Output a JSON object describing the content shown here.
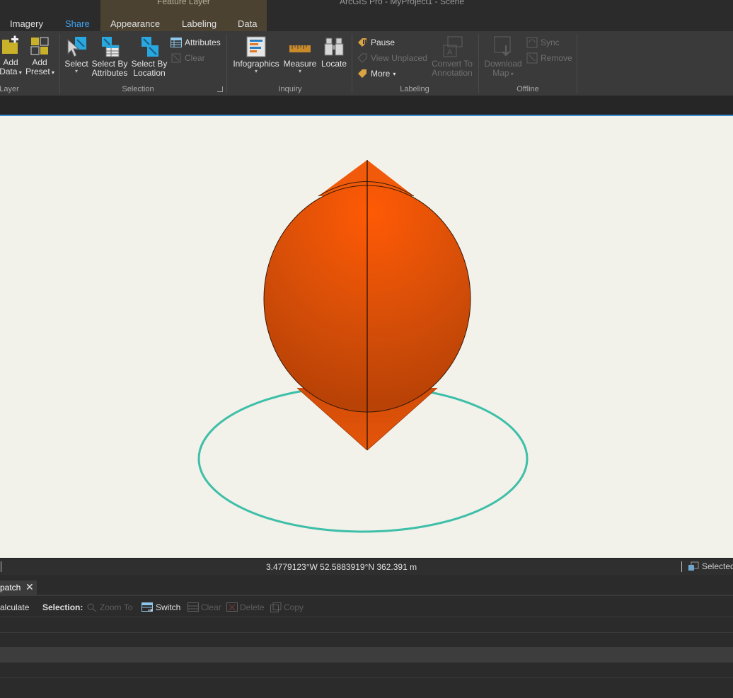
{
  "app": {
    "title": "ArcGIS Pro - MyProject1 - Scene",
    "contextual_tab_group": "Feature Layer"
  },
  "tabs": [
    {
      "label": "Imagery",
      "active": false
    },
    {
      "label": "Share",
      "active": true
    },
    {
      "label": "Appearance",
      "active": false
    },
    {
      "label": "Labeling",
      "active": false
    },
    {
      "label": "Data",
      "active": false
    }
  ],
  "ribbon": {
    "layer_group": {
      "label": "Layer",
      "add_data": [
        "Add",
        "Data"
      ],
      "add_preset": [
        "Add",
        "Preset"
      ]
    },
    "selection_group": {
      "label": "Selection",
      "select": "Select",
      "select_by_attributes": [
        "Select By",
        "Attributes"
      ],
      "select_by_location": [
        "Select By",
        "Location"
      ],
      "attributes": "Attributes",
      "clear": "Clear"
    },
    "inquiry_group": {
      "label": "Inquiry",
      "infographics": "Infographics",
      "measure": "Measure",
      "locate": "Locate"
    },
    "labeling_group": {
      "label": "Labeling",
      "pause": "Pause",
      "view_unplaced": "View Unplaced",
      "more": "More",
      "convert_to_annotation": [
        "Convert To",
        "Annotation"
      ]
    },
    "offline_group": {
      "label": "Offline",
      "download_map": [
        "Download",
        "Map"
      ],
      "sync": "Sync",
      "remove": "Remove"
    }
  },
  "scene": {
    "colors": {
      "background": "#f2f1ea",
      "shape_fill": "#d2500a",
      "shape_highlight": "#ff5a05",
      "ring": "#3dbfa8"
    }
  },
  "status": {
    "coordinates": "3.4779123°W 52.5883919°N   362.391 m",
    "selected": "Selected"
  },
  "attribute_pane": {
    "tab_label": "patch",
    "tools": {
      "calculate": "alculate",
      "selection_label": "Selection:",
      "zoom_to": "Zoom To",
      "switch": "Switch",
      "clear": "Clear",
      "delete": "Delete",
      "copy": "Copy"
    }
  },
  "accent_color": "#3ea3ef"
}
